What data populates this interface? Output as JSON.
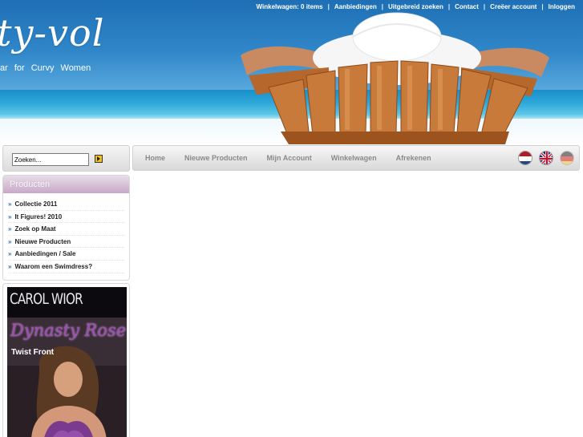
{
  "header": {
    "logo_text": "ty-vol",
    "tagline": "ar for Curvy Women",
    "top_links": [
      {
        "label": "Winkelwagen: 0 items"
      },
      {
        "label": "Aanbiedingen"
      },
      {
        "label": "Uitgebreid zoeken"
      },
      {
        "label": "Contact"
      },
      {
        "label": "Creëer account"
      },
      {
        "label": "Inloggen"
      }
    ]
  },
  "search": {
    "placeholder": "Zoeken...",
    "value": "Zoeken...",
    "button_icon": "arrow-right-icon"
  },
  "sidebar": {
    "categories_title": "Producten",
    "items": [
      {
        "label": "Collectie 2011"
      },
      {
        "label": "It Figures! 2010"
      },
      {
        "label": "Zoek op Maat"
      },
      {
        "label": "Nieuwe Producten"
      },
      {
        "label": "Aanbiedingen / Sale"
      },
      {
        "label": "Waarom een Swimdress?"
      }
    ],
    "bullet": "»"
  },
  "ad": {
    "brand": "CAROL WIOR",
    "title": "Dynasty Rose",
    "subtitle": "Twist Front"
  },
  "nav": {
    "items": [
      {
        "label": "Home"
      },
      {
        "label": "Nieuwe Producten"
      },
      {
        "label": "Mijn Account"
      },
      {
        "label": "Winkelwagen"
      },
      {
        "label": "Afrekenen"
      }
    ],
    "languages": [
      {
        "name": "dutch-flag-icon"
      },
      {
        "name": "english-flag-icon"
      },
      {
        "name": "german-flag-icon"
      }
    ]
  },
  "colors": {
    "link_bullet": "#2a6fb8",
    "nav_text": "#8a8a8a",
    "category_header": "#c8a8c8",
    "sky": "#2f86c8"
  }
}
